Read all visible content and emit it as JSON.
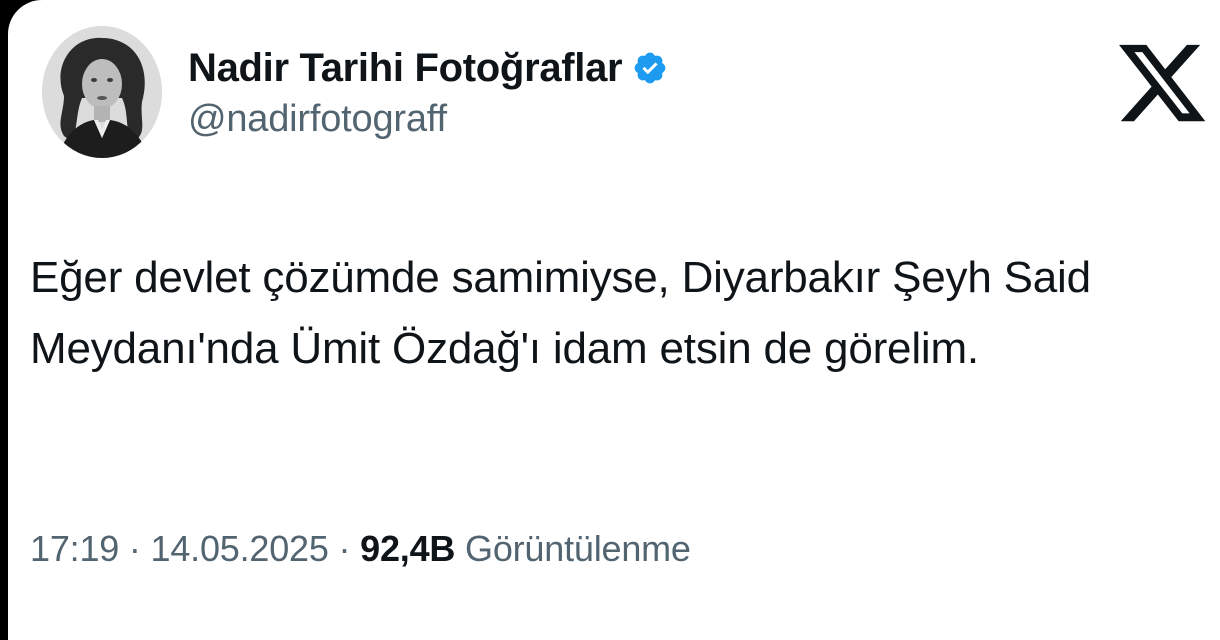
{
  "author": {
    "display_name": "Nadir Tarihi Fotoğraflar",
    "handle": "@nadirfotograff",
    "verified": true,
    "avatar_icon": "portrait-photo-avatar"
  },
  "platform_logo": "x-logo-icon",
  "tweet": {
    "text": "Eğer devlet çözümde samimiyse, Diyarbakır Şeyh Said Meydanı'nda Ümit Özdağ'ı idam etsin de görelim."
  },
  "meta": {
    "time": "17:19",
    "separator": "·",
    "date": "14.05.2025",
    "views_count": "92,4B",
    "views_label": "Görüntülenme"
  },
  "colors": {
    "text_primary": "#0f1419",
    "text_secondary": "#536471",
    "verified_blue": "#1d9bf0",
    "background": "#ffffff"
  }
}
